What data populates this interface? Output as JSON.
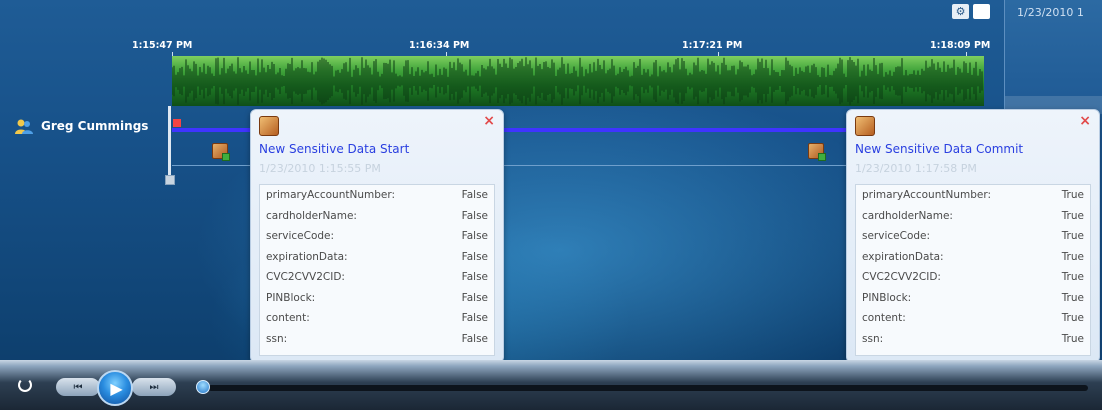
{
  "window": {
    "date_label": "1/23/2010 1"
  },
  "timeline": {
    "ticks": [
      "1:15:47 PM",
      "1:16:34 PM",
      "1:17:21 PM",
      "1:18:09 PM"
    ],
    "user": "Greg Cummings"
  },
  "icons": {
    "user": "user-icon",
    "event": "sensitive-data-event-icon",
    "close": "close-icon",
    "settings": "gear-icon",
    "power": "power-icon",
    "play": "play-icon",
    "prev": "previous-icon",
    "next": "next-icon"
  },
  "popups": [
    {
      "title": "New Sensitive Data Start",
      "timestamp": "1/23/2010 1:15:55 PM",
      "close": "×",
      "rows": [
        {
          "key": "primaryAccountNumber:",
          "value": "False"
        },
        {
          "key": "cardholderName:",
          "value": "False"
        },
        {
          "key": "serviceCode:",
          "value": "False"
        },
        {
          "key": "expirationData:",
          "value": "False"
        },
        {
          "key": "CVC2CVV2CID:",
          "value": "False"
        },
        {
          "key": "PINBlock:",
          "value": "False"
        },
        {
          "key": "content:",
          "value": "False"
        },
        {
          "key": "ssn:",
          "value": "False"
        }
      ]
    },
    {
      "title": "New Sensitive Data Commit",
      "timestamp": "1/23/2010 1:17:58 PM",
      "close": "×",
      "rows": [
        {
          "key": "primaryAccountNumber:",
          "value": "True"
        },
        {
          "key": "cardholderName:",
          "value": "True"
        },
        {
          "key": "serviceCode:",
          "value": "True"
        },
        {
          "key": "expirationData:",
          "value": "True"
        },
        {
          "key": "CVC2CVV2CID:",
          "value": "True"
        },
        {
          "key": "PINBlock:",
          "value": "True"
        },
        {
          "key": "content:",
          "value": "True"
        },
        {
          "key": "ssn:",
          "value": "True"
        }
      ]
    }
  ],
  "colors": {
    "waveform": "#2f8f2f",
    "track": "#3f34ff",
    "title_link": "#2a3fe0",
    "close": "#e24a4a"
  }
}
